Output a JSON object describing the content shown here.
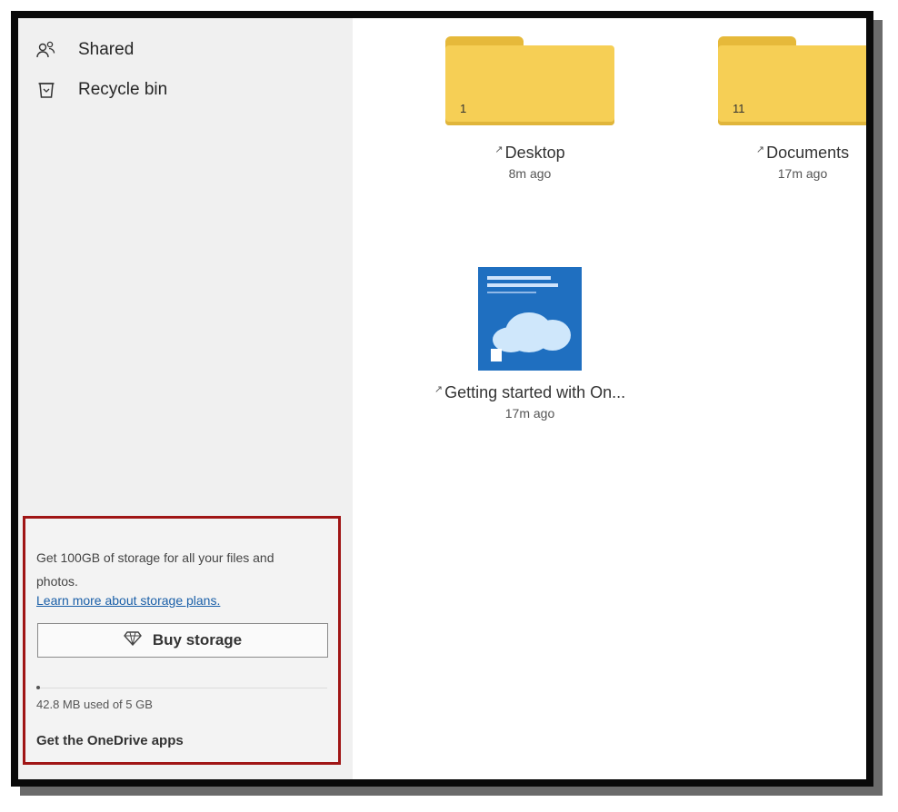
{
  "sidebar": {
    "items": [
      {
        "label": "Shared",
        "icon": "shared-people-icon"
      },
      {
        "label": "Recycle bin",
        "icon": "recycle-bin-icon"
      }
    ]
  },
  "storage": {
    "promo": "Get 100GB of storage for all your files and photos.",
    "learn_more": "Learn more about storage plans.",
    "buy_button": "Buy storage",
    "buy_icon": "diamond-icon",
    "usage": "42.8 MB used of 5 GB",
    "usage_fraction": 0.008,
    "apps_link": "Get the OneDrive apps"
  },
  "files": [
    {
      "type": "folder",
      "name": "Desktop",
      "count": "1",
      "modified": "8m ago"
    },
    {
      "type": "folder",
      "name": "Documents",
      "count": "11",
      "modified": "17m ago"
    },
    {
      "type": "document",
      "name": "Getting started with On...",
      "modified": "17m ago",
      "thumbnail_text": "Get started with Microsoft OneDrive"
    }
  ],
  "colors": {
    "folder": "#f6cf55",
    "highlight_border": "#a01515",
    "link": "#1a5fa8"
  }
}
